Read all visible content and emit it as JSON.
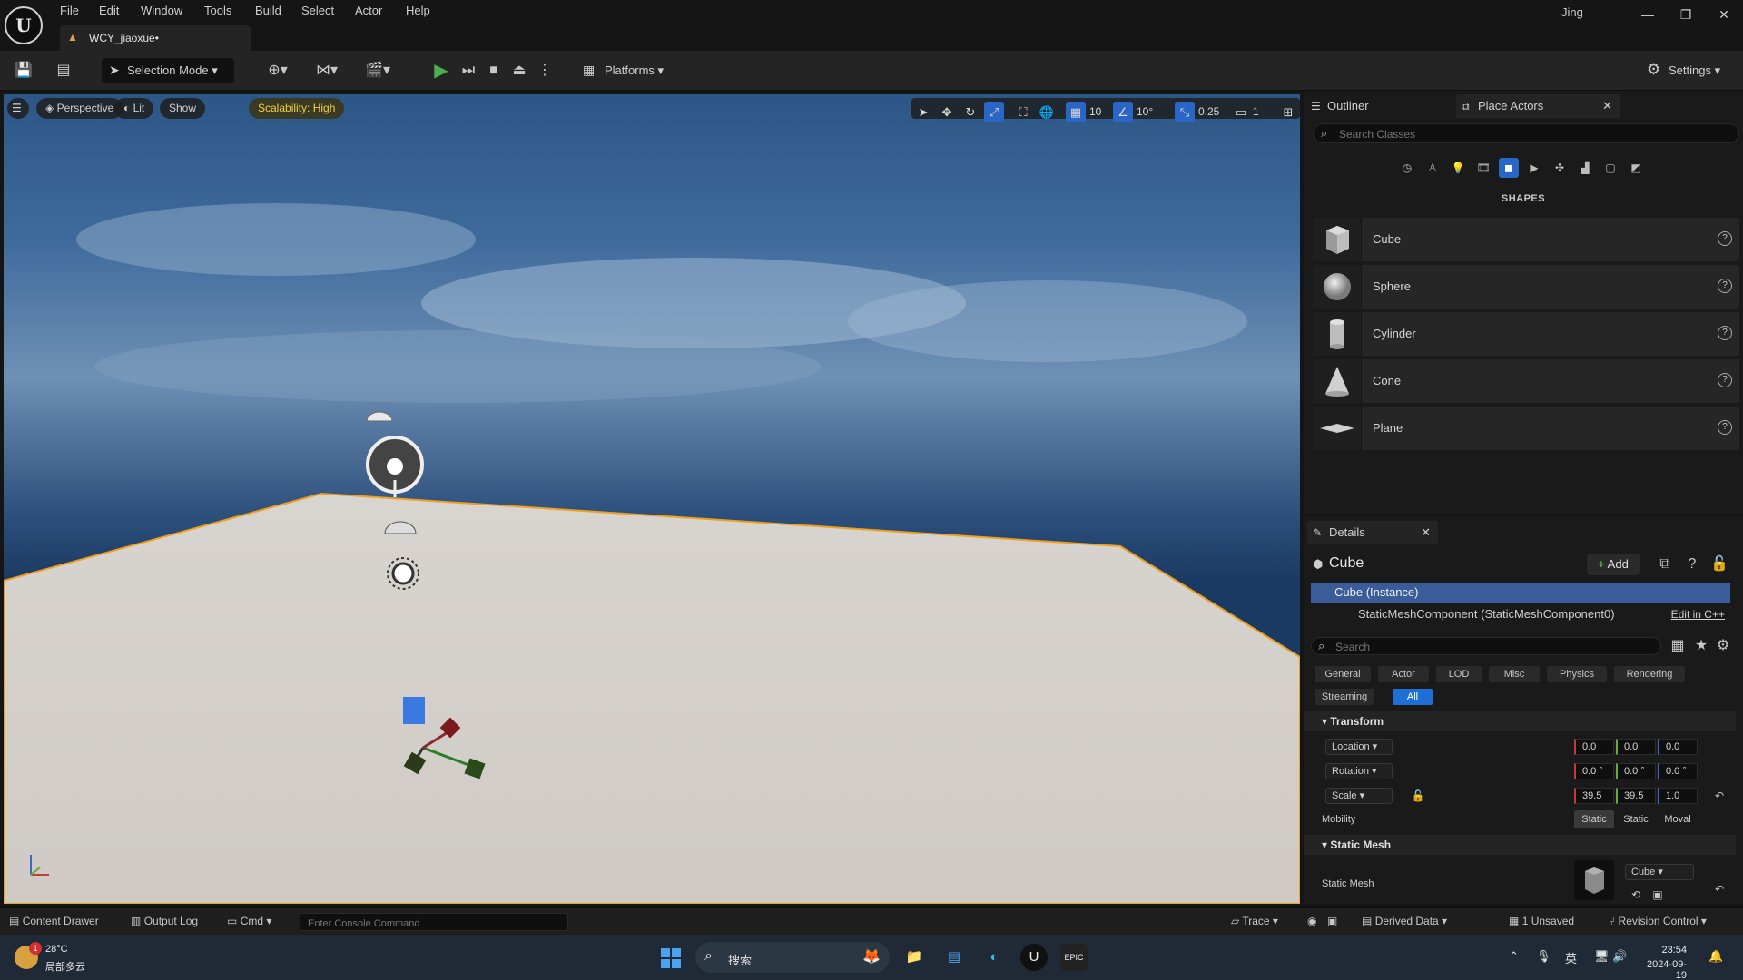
{
  "menubar": {
    "logo": "U",
    "items": [
      "File",
      "Edit",
      "Window",
      "Tools",
      "Build",
      "Select",
      "Actor",
      "Help"
    ],
    "user": "Jing",
    "window_controls": [
      "minimize-icon",
      "restore-icon",
      "close-icon"
    ]
  },
  "doc_tab": {
    "label": "WCY_jiaoxue•"
  },
  "toolbar": {
    "selection_mode": "Selection Mode",
    "platforms": "Platforms",
    "settings": "Settings",
    "play_color": "#4caf50"
  },
  "viewport": {
    "perspective": "Perspective",
    "lit": "Lit",
    "show": "Show",
    "scalability": "Scalability: High",
    "grid_snap": "10",
    "rotation_snap": "10°",
    "scale_snap": "0.25",
    "camera_speed": "1",
    "floor_outline_color": "#f0a020"
  },
  "outliner": {
    "tab_outliner": "Outliner",
    "tab_place_actors": "Place Actors",
    "search_placeholder": "Search Classes",
    "section": "SHAPES",
    "actors": [
      "Cube",
      "Sphere",
      "Cylinder",
      "Cone",
      "Plane"
    ]
  },
  "details": {
    "tab": "Details",
    "title": "Cube",
    "add": "Add",
    "component_selected": "Cube (Instance)",
    "component_sub": "StaticMeshComponent (StaticMeshComponent0)",
    "edit_cpp": "Edit in C++",
    "search_placeholder": "Search",
    "filters": [
      "General",
      "Actor",
      "LOD",
      "Misc",
      "Physics",
      "Rendering",
      "Streaming",
      "All"
    ],
    "transform_header": "Transform",
    "location_label": "Location",
    "location": [
      "0.0",
      "0.0",
      "0.0"
    ],
    "rotation_label": "Rotation",
    "rotation": [
      "0.0 °",
      "0.0 °",
      "0.0 °"
    ],
    "scale_label": "Scale",
    "scale": [
      "39.5",
      "39.5",
      "1.0"
    ],
    "mobility_label": "Mobility",
    "mobility": [
      "Static",
      "Static",
      "Moval"
    ],
    "static_mesh_header": "Static Mesh",
    "static_mesh_label": "Static Mesh",
    "static_mesh_value": "Cube"
  },
  "statusbar": {
    "content_drawer": "Content Drawer",
    "output_log": "Output Log",
    "cmd": "Cmd",
    "console_placeholder": "Enter Console Command",
    "trace": "Trace",
    "derived_data": "Derived Data",
    "unsaved": "1 Unsaved",
    "revision_control": "Revision Control"
  },
  "taskbar": {
    "weather_temp": "28°C",
    "weather_desc": "局部多云",
    "weather_badge": "1",
    "search": "搜索",
    "lang": "英",
    "time": "23:54",
    "date": "2024-09-19"
  }
}
